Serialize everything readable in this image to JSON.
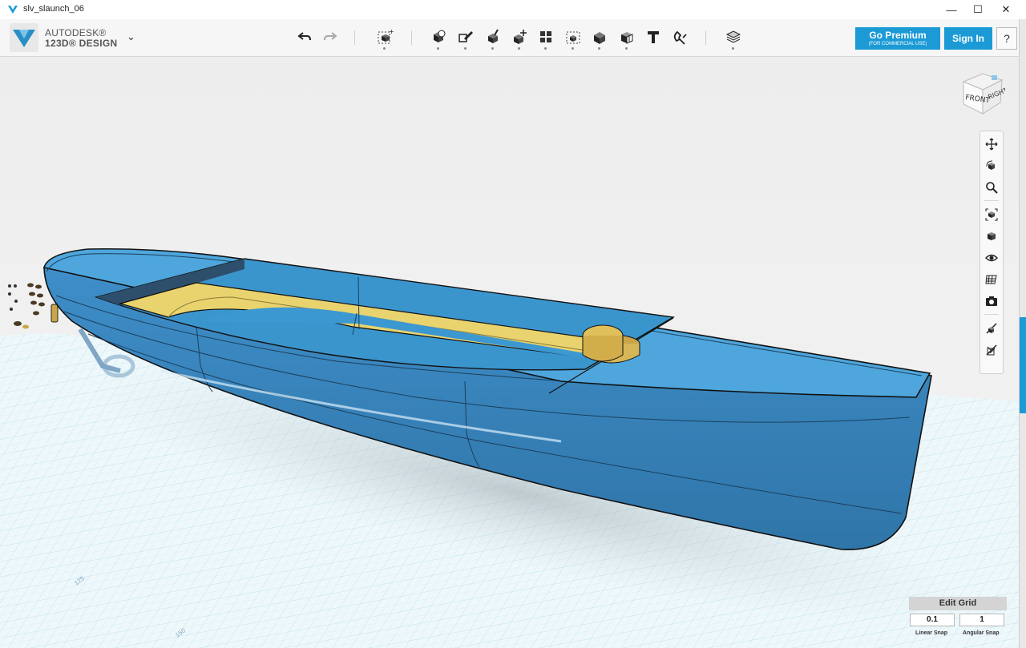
{
  "window": {
    "title": "slv_slaunch_06",
    "controls": {
      "minimize": "—",
      "maximize": "☐",
      "close": "✕"
    }
  },
  "brand": {
    "line1": "AUTODESK®",
    "line2": "123D® DESIGN",
    "menu_caret": "⌄"
  },
  "toolbar": {
    "tools": [
      "undo-icon",
      "redo-icon",
      "transform-icon",
      "primitives-icon",
      "sketch-icon",
      "construct-icon",
      "modify-icon",
      "pattern-icon",
      "grouping-icon",
      "combine-icon",
      "measure-icon",
      "text-icon",
      "snap-icon",
      "materials-icon"
    ]
  },
  "account": {
    "premium_label": "Go Premium",
    "premium_sub": "(FOR COMMERCIAL USE)",
    "signin_label": "Sign In",
    "help_label": "?"
  },
  "viewcube": {
    "front": "FRONT",
    "right": "RIGHT"
  },
  "navbar": {
    "tools": [
      "pan-icon",
      "orbit-icon",
      "zoom-icon",
      "fit-icon",
      "view-icon",
      "visibility-icon",
      "material-view-icon",
      "screenshot-icon",
      "snap-view-icon",
      "hide-sketch-icon"
    ]
  },
  "edit_grid": {
    "title": "Edit Grid",
    "linear_snap": "0.1",
    "angular_snap": "1",
    "linear_label": "Linear Snap",
    "angular_label": "Angular Snap"
  },
  "grid_labels": {
    "a": "125",
    "b": "150"
  },
  "colors": {
    "accent": "#1b9ad6",
    "hull": "#3a87c0",
    "deck": "#e9d36e",
    "grid": "#bfe3ef"
  }
}
